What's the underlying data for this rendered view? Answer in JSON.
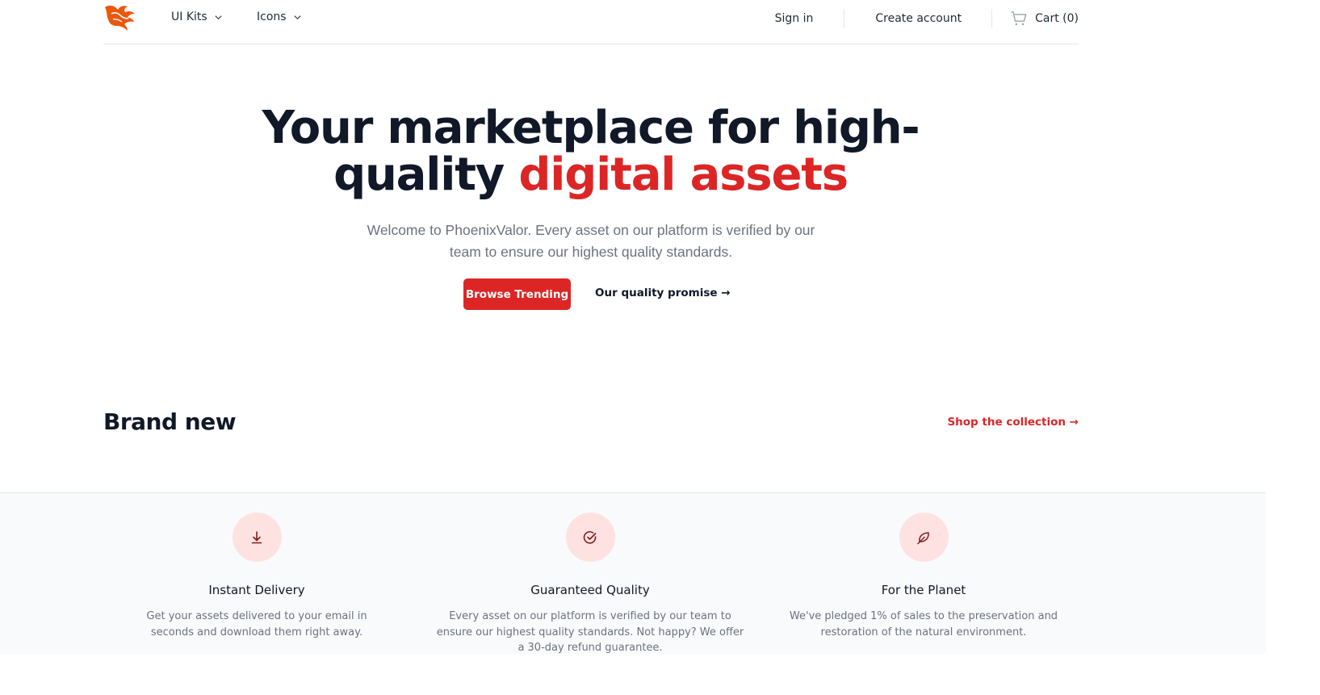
{
  "nav": {
    "menus": [
      {
        "label": "UI Kits"
      },
      {
        "label": "Icons"
      }
    ],
    "sign_in": "Sign in",
    "create_account": "Create account",
    "cart": "Cart (0)"
  },
  "hero": {
    "title_part1": "Your marketplace for high-",
    "title_part2": "quality ",
    "title_accent": "digital assets",
    "subtitle": "Welcome to PhoenixValor. Every asset on our platform is verified by our team to ensure our highest quality standards.",
    "primary_button": "Browse Trending",
    "secondary_link": "Our quality promise →"
  },
  "brand_new": {
    "title": "Brand new",
    "shop_link": "Shop the collection →"
  },
  "features": [
    {
      "icon": "download-icon",
      "title": "Instant Delivery",
      "text": "Get your assets delivered to your email in seconds and download them right away."
    },
    {
      "icon": "check-circle-icon",
      "title": "Guaranteed Quality",
      "text": "Every asset on our platform is verified by our team to ensure our highest quality standards. Not happy? We offer a 30-day refund guarantee."
    },
    {
      "icon": "leaf-icon",
      "title": "For the Planet",
      "text": "We've pledged 1% of sales to the preservation and restoration of the natural environment."
    }
  ],
  "colors": {
    "accent": "#dc2626",
    "accent_light": "#fee2e2",
    "logo": "#ea580c",
    "text_dark": "#111827",
    "text_muted": "#6b7280"
  }
}
